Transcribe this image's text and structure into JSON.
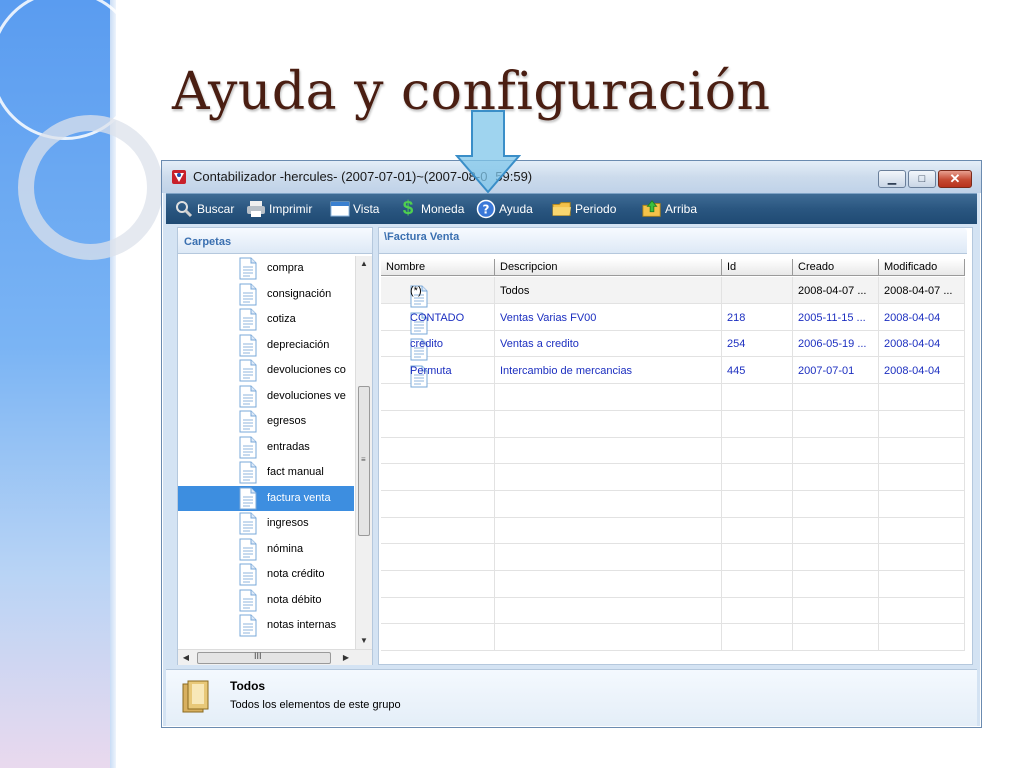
{
  "slide": {
    "title": "Ayuda y configuración"
  },
  "window": {
    "title": "Contabilizador -hercules- (2007-07-01)~(2007-08-0   59:59)",
    "controls": {
      "minimize": "▁",
      "maximize": "□",
      "close": "✕"
    }
  },
  "toolbar": {
    "buttons": [
      {
        "label": "Buscar",
        "icon": "search-icon"
      },
      {
        "label": "Imprimir",
        "icon": "printer-icon"
      },
      {
        "label": "Vista",
        "icon": "window-icon"
      },
      {
        "label": "Moneda",
        "icon": "dollar-icon"
      },
      {
        "label": "Ayuda",
        "icon": "help-icon"
      },
      {
        "label": "Periodo",
        "icon": "folder-icon"
      },
      {
        "label": "Arriba",
        "icon": "folder-up-icon"
      }
    ]
  },
  "left_pane": {
    "tab": "Carpetas",
    "items": [
      {
        "label": "compra",
        "selected": false
      },
      {
        "label": "consignación",
        "selected": false
      },
      {
        "label": "cotiza",
        "selected": false
      },
      {
        "label": "depreciación",
        "selected": false
      },
      {
        "label": "devoluciones co",
        "selected": false
      },
      {
        "label": "devoluciones ve",
        "selected": false
      },
      {
        "label": "egresos",
        "selected": false
      },
      {
        "label": "entradas",
        "selected": false
      },
      {
        "label": "fact manual",
        "selected": false
      },
      {
        "label": "factura venta",
        "selected": true
      },
      {
        "label": "ingresos",
        "selected": false
      },
      {
        "label": "nómina",
        "selected": false
      },
      {
        "label": "nota crédito",
        "selected": false
      },
      {
        "label": "nota débito",
        "selected": false
      },
      {
        "label": "notas internas",
        "selected": false
      }
    ],
    "scroll_grip": "≡",
    "hscroll_grip": "III"
  },
  "right_pane": {
    "tab": "\\Factura Venta",
    "columns": [
      "Nombre",
      "Descripcion",
      "Id",
      "Creado",
      "Modificado"
    ],
    "rows": [
      {
        "nombre": "(*)",
        "descripcion": "Todos",
        "id": "",
        "creado": "2008-04-07 ...",
        "modificado": "2008-04-07 ..."
      },
      {
        "nombre": "CONTADO",
        "descripcion": "Ventas Varias FV00",
        "id": "218",
        "creado": "2005-11-15 ...",
        "modificado": "2008-04-04"
      },
      {
        "nombre": "credito",
        "descripcion": "Ventas a credito",
        "id": "254",
        "creado": "2006-05-19 ...",
        "modificado": "2008-04-04"
      },
      {
        "nombre": "Permuta",
        "descripcion": "Intercambio de mercancias",
        "id": "445",
        "creado": "2007-07-01",
        "modificado": "2008-04-04"
      }
    ]
  },
  "status": {
    "title": "Todos",
    "description": "Todos los elementos de este grupo"
  },
  "colors": {
    "toolbar": "#2a5680",
    "selected": "#3d8ee0",
    "link": "#1c2fc0",
    "title": "#4a1e12"
  }
}
